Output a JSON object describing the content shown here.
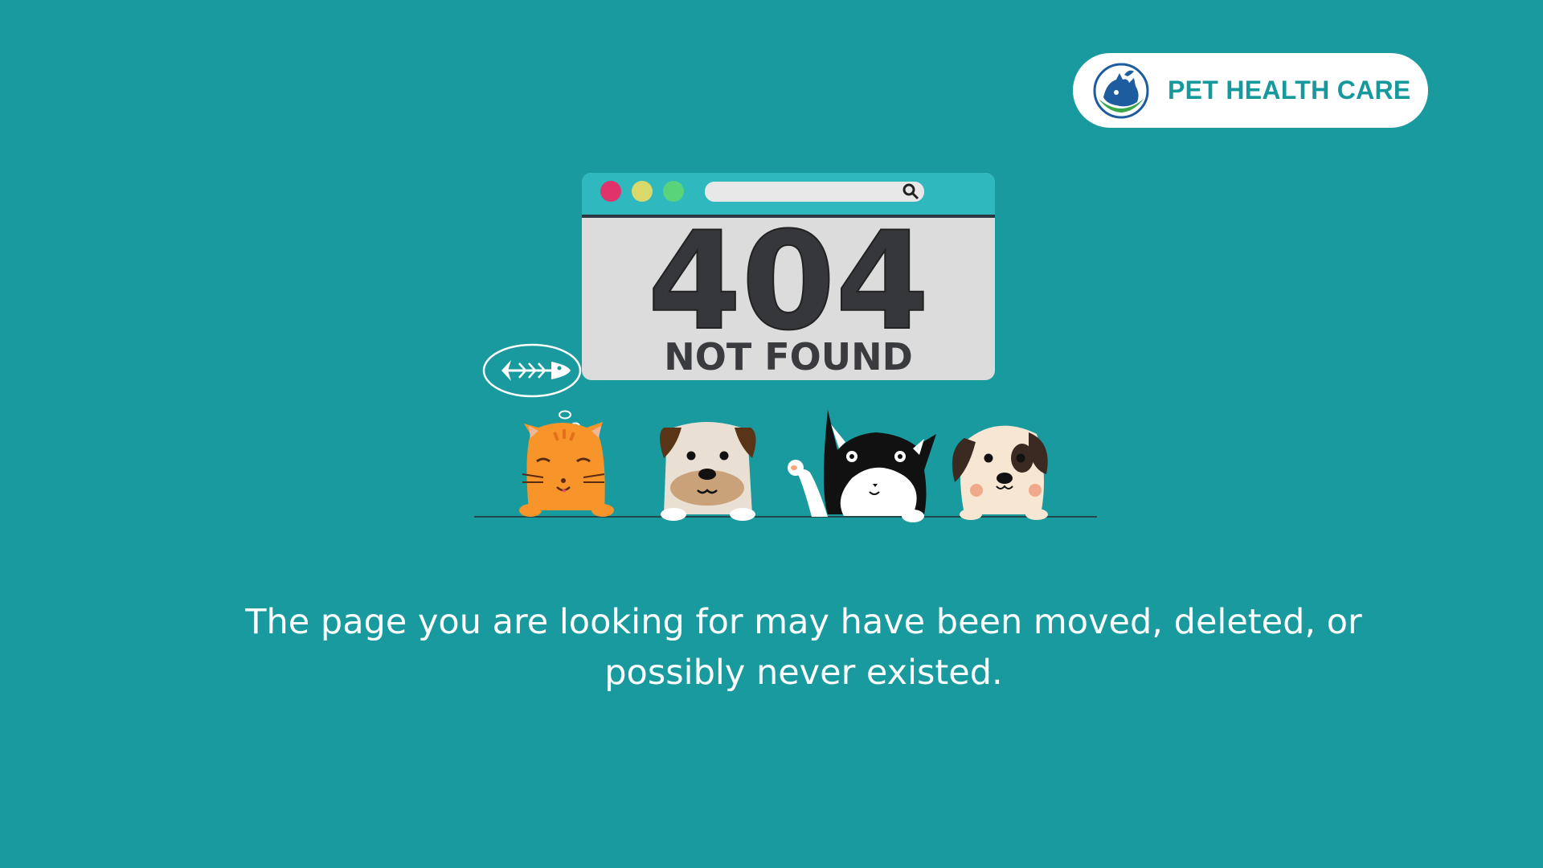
{
  "brand": {
    "name": "PET HEALTH CARE",
    "emblem_icon": "pet-emblem-icon",
    "text_color": "#16999c"
  },
  "browser_window": {
    "code": "404",
    "caption": "NOT FOUND",
    "dots": [
      "#e0336b",
      "#d9d96b",
      "#5ad47a"
    ],
    "search_icon": "magnifier-icon"
  },
  "thought_bubble": {
    "icon": "fish-bone-icon"
  },
  "pets": [
    {
      "kind": "orange-cat"
    },
    {
      "kind": "pug-dog"
    },
    {
      "kind": "tuxedo-cat"
    },
    {
      "kind": "spotted-dog"
    }
  ],
  "message": "The page you are looking for may have been moved, deleted, or possibly never existed.",
  "colors": {
    "background": "#189a9e",
    "pill": "#ffffff",
    "message_text": "#ffffff"
  }
}
